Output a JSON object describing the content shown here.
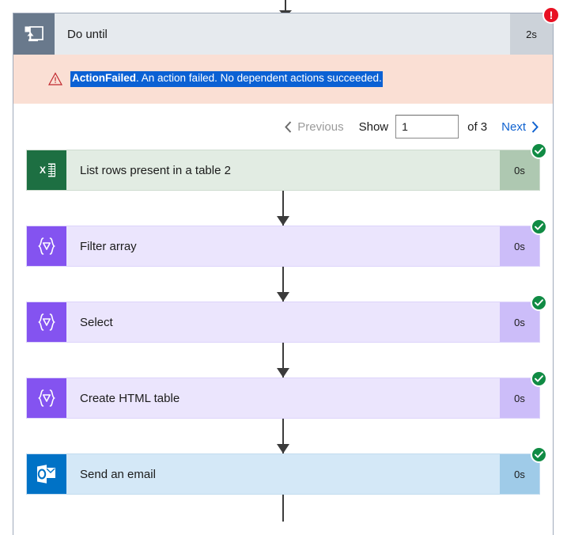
{
  "scope": {
    "icon": "do-until-loop-icon",
    "title": "Do until",
    "duration": "2s",
    "status": "failed",
    "status_badge_glyph": "!",
    "error": {
      "icon": "warning-triangle-icon",
      "code": "ActionFailed",
      "message": ". An action failed. No dependent actions succeeded.",
      "selected": true,
      "selection_bg": "#0b61d4",
      "selection_fg": "#ffffff",
      "banner_bg": "#fadfd4"
    }
  },
  "pagination": {
    "previous_label": "Previous",
    "previous_enabled": false,
    "show_label": "Show",
    "page_value": "1",
    "page_placeholder": "",
    "of_label": "of 3",
    "next_label": "Next",
    "next_enabled": true,
    "next_color": "#0f62d0",
    "previous_color": "#9b9b9b"
  },
  "actions": [
    {
      "name": "List rows present in a table 2",
      "duration": "0s",
      "status": "succeeded",
      "icon": "excel-icon",
      "theme": "theme-excel",
      "accent": "#1d6f42"
    },
    {
      "name": "Filter array",
      "duration": "0s",
      "status": "succeeded",
      "icon": "data-operation-filter-icon",
      "theme": "theme-data",
      "accent": "#8453f0"
    },
    {
      "name": "Select",
      "duration": "0s",
      "status": "succeeded",
      "icon": "data-operation-filter-icon",
      "theme": "theme-data",
      "accent": "#8453f0"
    },
    {
      "name": "Create HTML table",
      "duration": "0s",
      "status": "succeeded",
      "icon": "data-operation-filter-icon",
      "theme": "theme-data",
      "accent": "#8453f0"
    },
    {
      "name": "Send an email",
      "duration": "0s",
      "status": "succeeded",
      "icon": "outlook-icon",
      "theme": "theme-outlook",
      "accent": "#0072c6"
    }
  ],
  "colors": {
    "error_red": "#e81123",
    "success_green": "#108b44",
    "scope_header_bg": "#e6eaee",
    "scope_icon_bg": "#69798c",
    "scope_duration_bg": "#ccd2d9",
    "connector": "#3b3b3b"
  }
}
